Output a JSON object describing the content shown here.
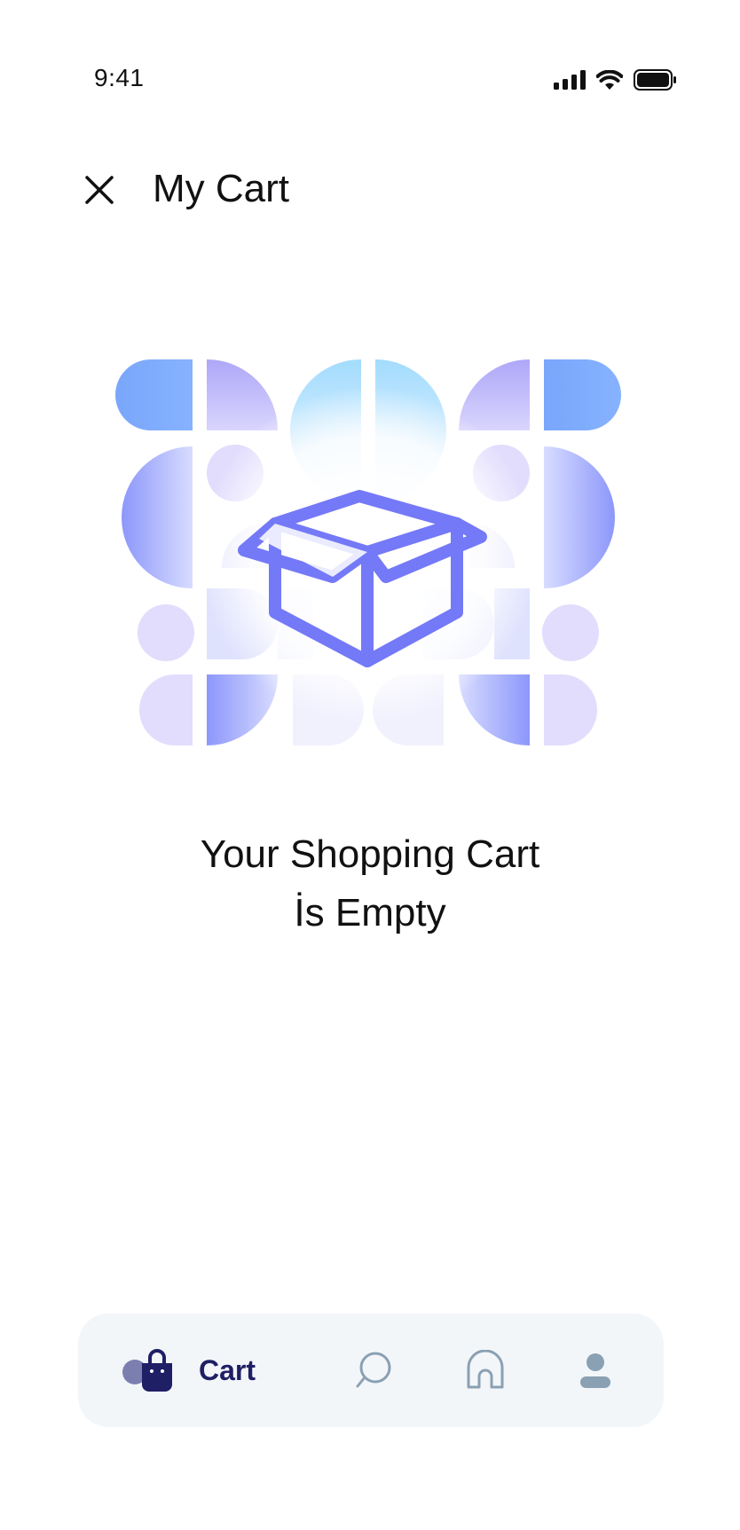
{
  "status_bar": {
    "time": "9:41",
    "icons": [
      "signal-icon",
      "wifi-icon",
      "battery-icon"
    ]
  },
  "header": {
    "close_icon": "close-icon",
    "title": "My Cart"
  },
  "illustration": {
    "icon": "open-box-icon",
    "accent_color": "#7479f7"
  },
  "empty_state": {
    "line1": "Your Shopping Cart",
    "line2": "İs Empty"
  },
  "bottom_nav": {
    "items": [
      {
        "label": "Cart",
        "icon": "shopping-bag-icon",
        "active": true
      },
      {
        "label": "",
        "icon": "chat-icon",
        "active": false
      },
      {
        "label": "",
        "icon": "home-icon",
        "active": false
      },
      {
        "label": "",
        "icon": "profile-icon",
        "active": false
      }
    ],
    "active_color": "#1f1f66",
    "inactive_color": "#8aa0b3",
    "background": "#f3f6f9"
  }
}
